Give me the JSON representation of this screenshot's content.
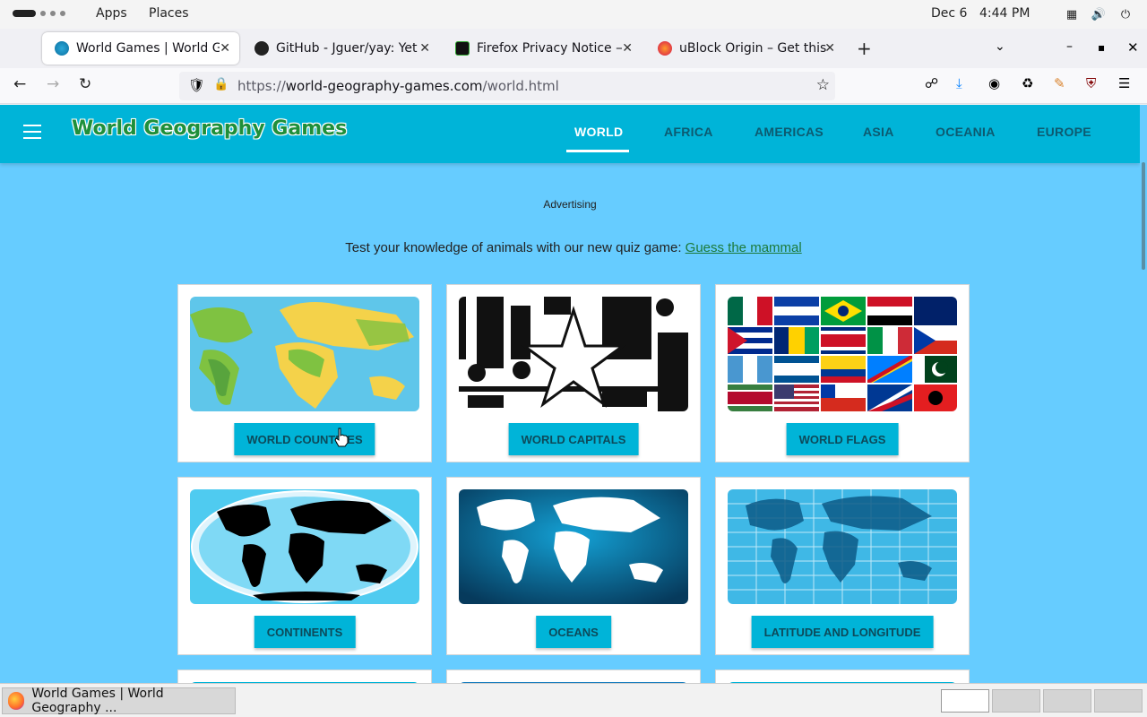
{
  "system": {
    "apps": "Apps",
    "places": "Places",
    "date": "Dec 6",
    "time": "4:44 PM"
  },
  "tabs": [
    {
      "title": "World Games | World Ge",
      "icon": "globe-icon"
    },
    {
      "title": "GitHub - Jguer/yay: Yet a",
      "icon": "github-icon"
    },
    {
      "title": "Firefox Privacy Notice —",
      "icon": "terminal-icon"
    },
    {
      "title": "uBlock Origin – Get this E",
      "icon": "firefox-icon"
    }
  ],
  "url": {
    "prefix": "https://",
    "host": "world-geography-games.com",
    "path": "/world.html"
  },
  "site": {
    "logo": "World Geography Games",
    "menu": [
      "WORLD",
      "AFRICA",
      "AMERICAS",
      "ASIA",
      "OCEANIA",
      "EUROPE"
    ],
    "advertising": "Advertising",
    "promo_text": "Test your knowledge of animals with our new quiz game: ",
    "promo_link": "Guess the mammal"
  },
  "cards": [
    {
      "label": "WORLD COUNTRIES"
    },
    {
      "label": "WORLD CAPITALS"
    },
    {
      "label": "WORLD FLAGS"
    },
    {
      "label": "CONTINENTS"
    },
    {
      "label": "OCEANS"
    },
    {
      "label": "LATITUDE AND LONGITUDE"
    }
  ],
  "taskbar": {
    "window_title": "World Games | World Geography ..."
  },
  "colors": {
    "page_bg": "#66ccff",
    "header_bg": "#00b4d8",
    "button_bg": "#00b4d8",
    "logo_green": "#1e8f3a"
  }
}
